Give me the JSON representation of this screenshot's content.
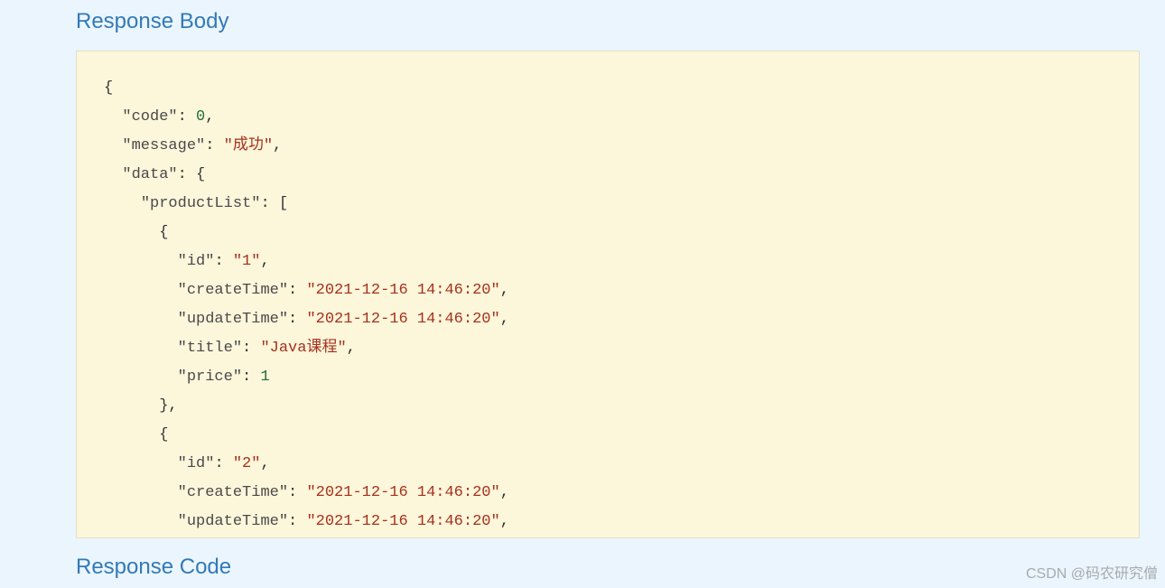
{
  "sections": {
    "response_body_title": "Response Body",
    "response_code_title": "Response Code"
  },
  "json_content": {
    "code": 0,
    "message": "成功",
    "data": {
      "productList": [
        {
          "id": "1",
          "createTime": "2021-12-16 14:46:20",
          "updateTime": "2021-12-16 14:46:20",
          "title": "Java课程",
          "price": 1
        },
        {
          "id": "2",
          "createTime": "2021-12-16 14:46:20",
          "updateTime": "2021-12-16 14:46:20"
        }
      ]
    }
  },
  "json_lines": [
    {
      "indent": 0,
      "tokens": [
        {
          "t": "pun",
          "v": "{"
        }
      ]
    },
    {
      "indent": 1,
      "tokens": [
        {
          "t": "key",
          "v": "\"code\""
        },
        {
          "t": "pun",
          "v": ": "
        },
        {
          "t": "num",
          "v": "0"
        },
        {
          "t": "pun",
          "v": ","
        }
      ]
    },
    {
      "indent": 1,
      "tokens": [
        {
          "t": "key",
          "v": "\"message\""
        },
        {
          "t": "pun",
          "v": ": "
        },
        {
          "t": "str",
          "v": "\"成功\""
        },
        {
          "t": "pun",
          "v": ","
        }
      ]
    },
    {
      "indent": 1,
      "tokens": [
        {
          "t": "key",
          "v": "\"data\""
        },
        {
          "t": "pun",
          "v": ": {"
        }
      ]
    },
    {
      "indent": 2,
      "tokens": [
        {
          "t": "key",
          "v": "\"productList\""
        },
        {
          "t": "pun",
          "v": ": ["
        }
      ]
    },
    {
      "indent": 3,
      "tokens": [
        {
          "t": "pun",
          "v": "{"
        }
      ]
    },
    {
      "indent": 4,
      "tokens": [
        {
          "t": "key",
          "v": "\"id\""
        },
        {
          "t": "pun",
          "v": ": "
        },
        {
          "t": "str",
          "v": "\"1\""
        },
        {
          "t": "pun",
          "v": ","
        }
      ]
    },
    {
      "indent": 4,
      "tokens": [
        {
          "t": "key",
          "v": "\"createTime\""
        },
        {
          "t": "pun",
          "v": ": "
        },
        {
          "t": "str",
          "v": "\"2021-12-16 14:46:20\""
        },
        {
          "t": "pun",
          "v": ","
        }
      ]
    },
    {
      "indent": 4,
      "tokens": [
        {
          "t": "key",
          "v": "\"updateTime\""
        },
        {
          "t": "pun",
          "v": ": "
        },
        {
          "t": "str",
          "v": "\"2021-12-16 14:46:20\""
        },
        {
          "t": "pun",
          "v": ","
        }
      ]
    },
    {
      "indent": 4,
      "tokens": [
        {
          "t": "key",
          "v": "\"title\""
        },
        {
          "t": "pun",
          "v": ": "
        },
        {
          "t": "str",
          "v": "\"Java课程\""
        },
        {
          "t": "pun",
          "v": ","
        }
      ]
    },
    {
      "indent": 4,
      "tokens": [
        {
          "t": "key",
          "v": "\"price\""
        },
        {
          "t": "pun",
          "v": ": "
        },
        {
          "t": "num",
          "v": "1"
        }
      ]
    },
    {
      "indent": 3,
      "tokens": [
        {
          "t": "pun",
          "v": "},"
        }
      ]
    },
    {
      "indent": 3,
      "tokens": [
        {
          "t": "pun",
          "v": "{"
        }
      ]
    },
    {
      "indent": 4,
      "tokens": [
        {
          "t": "key",
          "v": "\"id\""
        },
        {
          "t": "pun",
          "v": ": "
        },
        {
          "t": "str",
          "v": "\"2\""
        },
        {
          "t": "pun",
          "v": ","
        }
      ]
    },
    {
      "indent": 4,
      "tokens": [
        {
          "t": "key",
          "v": "\"createTime\""
        },
        {
          "t": "pun",
          "v": ": "
        },
        {
          "t": "str",
          "v": "\"2021-12-16 14:46:20\""
        },
        {
          "t": "pun",
          "v": ","
        }
      ]
    },
    {
      "indent": 4,
      "tokens": [
        {
          "t": "key",
          "v": "\"updateTime\""
        },
        {
          "t": "pun",
          "v": ": "
        },
        {
          "t": "str",
          "v": "\"2021-12-16 14:46:20\""
        },
        {
          "t": "pun",
          "v": ","
        }
      ]
    }
  ],
  "watermark": "CSDN @码农研究僧"
}
